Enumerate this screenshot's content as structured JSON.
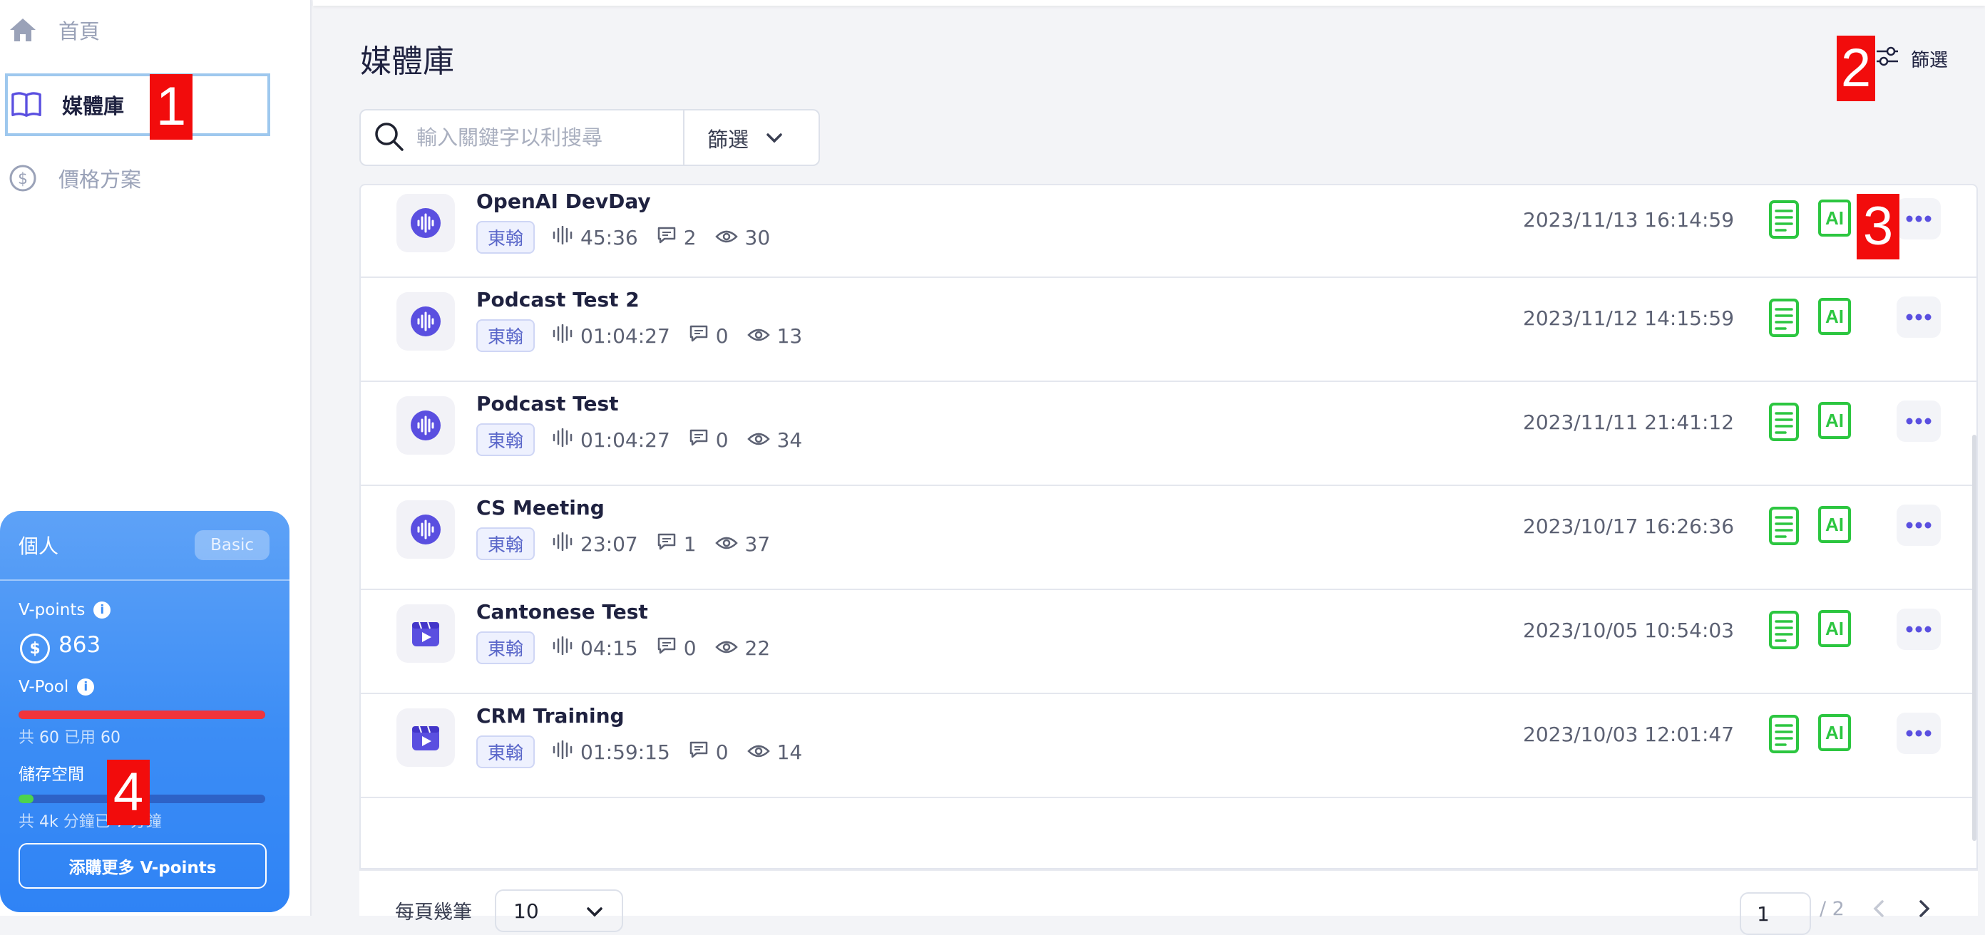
{
  "sidebar": {
    "items": [
      {
        "label": "首頁",
        "icon": "home-icon"
      },
      {
        "label": "媒體庫",
        "icon": "book-icon"
      },
      {
        "label": "價格方案",
        "icon": "dollar-icon"
      }
    ],
    "account_card": {
      "title": "個人",
      "plan": "Basic",
      "vpoints_label": "V-points",
      "vpoints_value": "863",
      "vpool_label": "V-Pool",
      "vpool_fraction": 1.0,
      "vpool_text_prefix": "共",
      "vpool_total": "60",
      "vpool_used_text": "已用",
      "vpool_used": "60",
      "storage_label": "儲存空間",
      "storage_fraction": 0.06,
      "storage_text_prefix": "共",
      "storage_total": "4k",
      "storage_unit": "分鐘已",
      "storage_used": "7",
      "storage_unit2": "分鐘",
      "buy_button": "添購更多 V-points"
    }
  },
  "annotations": [
    "1",
    "2",
    "3",
    "4"
  ],
  "main": {
    "title": "媒體庫",
    "filter_link": "篩選",
    "search_placeholder": "輸入關鍵字以利搜尋",
    "filter_dropdown": "篩選",
    "rows": [
      {
        "title": "OpenAI DevDay",
        "type": "audio",
        "tag": "東翰",
        "duration": "45:36",
        "comments": "2",
        "views": "30",
        "date": "2023/11/13 16:14:59"
      },
      {
        "title": "Podcast Test 2",
        "type": "audio",
        "tag": "東翰",
        "duration": "01:04:27",
        "comments": "0",
        "views": "13",
        "date": "2023/11/12 14:15:59"
      },
      {
        "title": "Podcast Test",
        "type": "audio",
        "tag": "東翰",
        "duration": "01:04:27",
        "comments": "0",
        "views": "34",
        "date": "2023/11/11 21:41:12"
      },
      {
        "title": "CS Meeting",
        "type": "audio",
        "tag": "東翰",
        "duration": "23:07",
        "comments": "1",
        "views": "37",
        "date": "2023/10/17 16:26:36"
      },
      {
        "title": "Cantonese Test",
        "type": "video",
        "tag": "東翰",
        "duration": "04:15",
        "comments": "0",
        "views": "22",
        "date": "2023/10/05 10:54:03"
      },
      {
        "title": "CRM Training",
        "type": "video",
        "tag": "東翰",
        "duration": "01:59:15",
        "comments": "0",
        "views": "14",
        "date": "2023/10/03 12:01:47"
      }
    ],
    "ai_label": "AI",
    "footer": {
      "per_page_label": "每頁幾筆",
      "per_page_value": "10",
      "current_page": "1",
      "total_pages": "/ 2"
    }
  },
  "colors": {
    "accent": "#5a4fe0",
    "green": "#2cc640",
    "red_badge": "#f20c0c",
    "card_blue": "#3c8df5"
  }
}
